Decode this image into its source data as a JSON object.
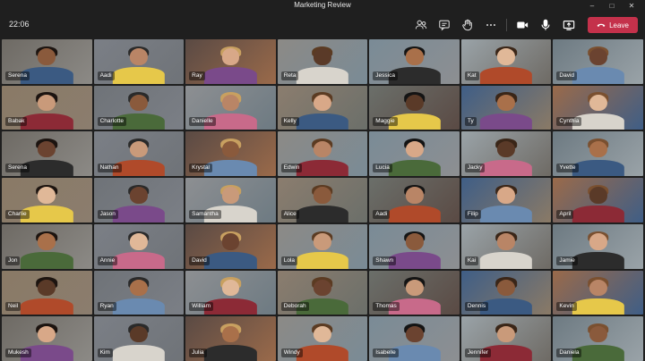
{
  "window": {
    "title": "Marketing Review"
  },
  "toolbar": {
    "timer": "22:06",
    "leave_label": "Leave"
  },
  "participants": [
    "Serena",
    "Aadi",
    "Ray",
    "Reta",
    "Jessica",
    "Kat",
    "David",
    "Babak",
    "Charlotte",
    "Danielle",
    "Kelly",
    "Maggie",
    "Ty",
    "Cynthia",
    "Serena",
    "Nathan",
    "Krystal",
    "Edwin",
    "Lucia",
    "Jacky",
    "Yvette",
    "Charlie",
    "Jason",
    "Samantha",
    "Alice",
    "Aadi",
    "Filip",
    "April",
    "Jon",
    "Annie",
    "David",
    "Lola",
    "Shawn",
    "Kai",
    "Jamie",
    "Neil",
    "Ryan",
    "William",
    "Deborah",
    "Thomas",
    "Dennis",
    "Kevin",
    "Mukesh",
    "Kim",
    "Julia",
    "Windy",
    "Isabelle",
    "Jennifer",
    "Daniela"
  ],
  "active_speaker": "Ray",
  "colors": {
    "leave": "#c4314b",
    "active_outline": "#8b8cf7"
  }
}
